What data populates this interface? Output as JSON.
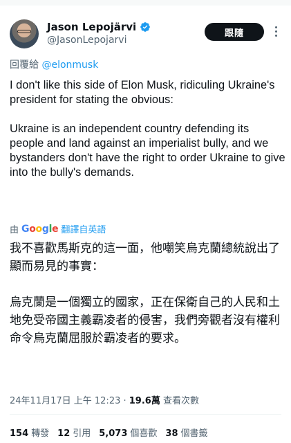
{
  "author": {
    "display_name": "Jason Lepojärvi",
    "handle": "@JasonLepojarvi",
    "verified": true,
    "follow_label": "跟隨"
  },
  "reply": {
    "prefix": "回覆給",
    "mention": "@elonmusk"
  },
  "tweet": {
    "paragraph1": "I don't like this side of Elon Musk, ridiculing Ukraine's president for stating the obvious:",
    "paragraph2": "Ukraine is an independent country defending its people and land against an imperialist bully, and we bystanders don't have the right to order Ukraine to give into the bully's demands."
  },
  "translation": {
    "by": "由",
    "provider": "Google",
    "link": "翻譯自英語",
    "paragraph1": "我不喜歡馬斯克的這一面，他嘲笑烏克蘭總統說出了顯而易見的事實：",
    "paragraph2": "烏克蘭是一個獨立的國家，正在保衛自己的人民和土地免受帝國主義霸凌者的侵害，我們旁觀者沒有權利命令烏克蘭屈服於霸凌者的要求。"
  },
  "meta": {
    "timestamp": "24年11月17日 上午 12:23",
    "separator": " · ",
    "views_count": "19.6萬",
    "views_label": "查看次數"
  },
  "stats": {
    "retweets_count": "154",
    "retweets_label": "轉發",
    "quotes_count": "12",
    "quotes_label": "引用",
    "likes_count": "5,073",
    "likes_label": "個喜歡",
    "bookmarks_count": "38",
    "bookmarks_label": "個書籤"
  },
  "colors": {
    "link": "#1d9bf0",
    "secondary_text": "#536471",
    "button_bg": "#0f1419"
  }
}
